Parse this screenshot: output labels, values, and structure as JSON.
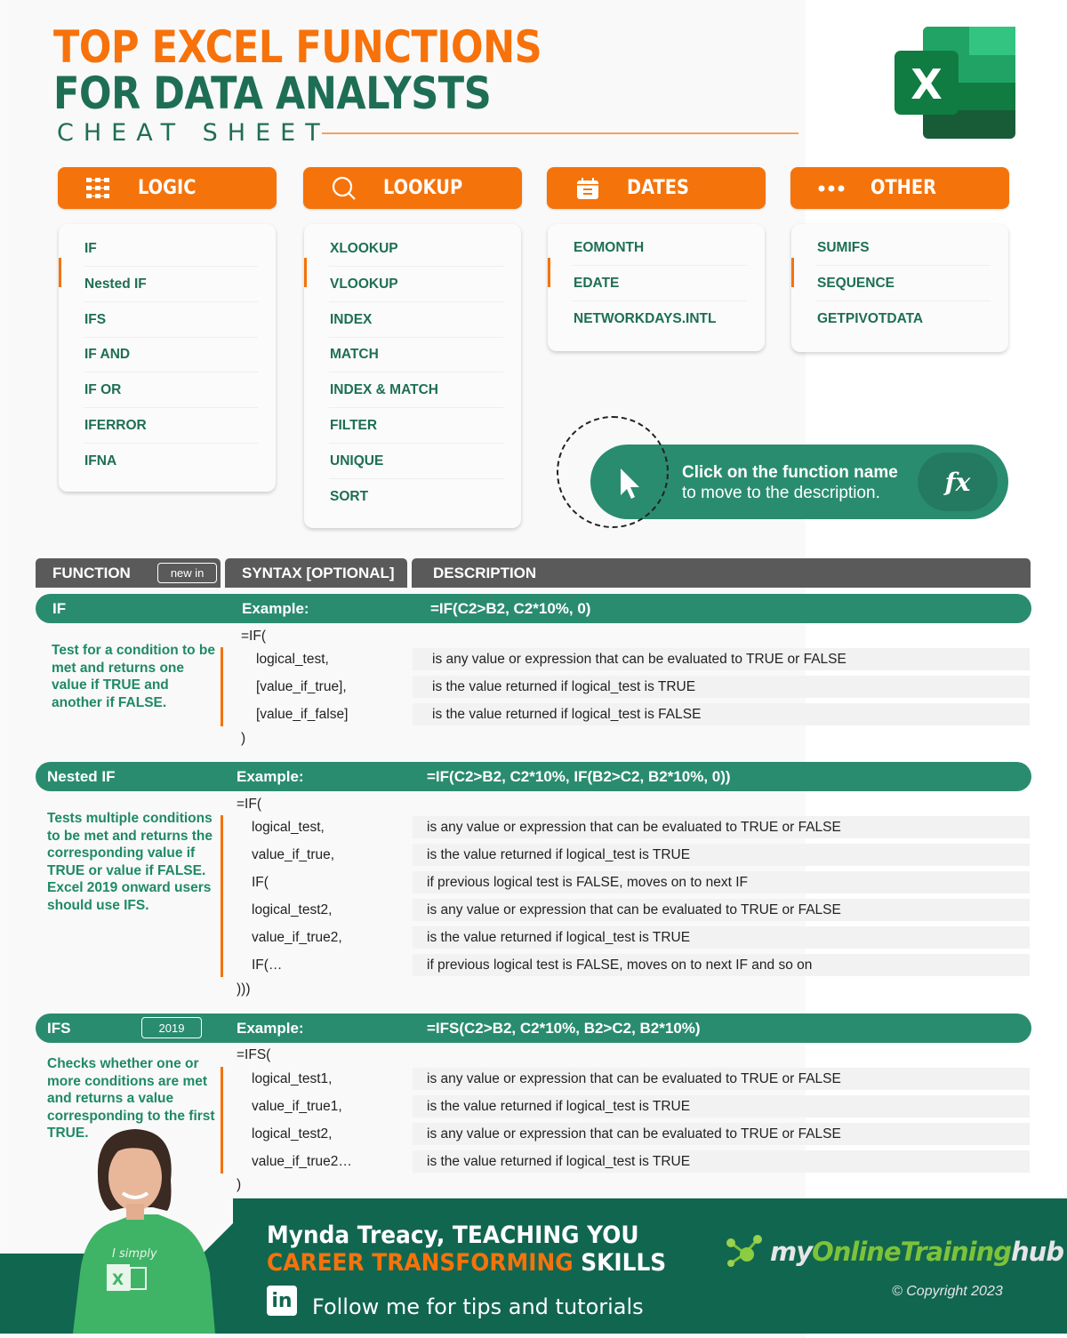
{
  "header": {
    "title_line1": "TOP EXCEL FUNCTIONS",
    "title_line2": "FOR DATA ANALYSTS",
    "subtitle": "CHEAT SHEET",
    "logo_letter": "X"
  },
  "colors": {
    "orange": "#f5730b",
    "green_dark": "#1e6e55",
    "green_bar": "#2a8c6e",
    "footer_green": "#116650",
    "header_gray": "#5a5a5a"
  },
  "categories": [
    {
      "label": "LOGIC",
      "icon": "flowchart-grid-icon",
      "items": [
        "IF",
        "Nested IF",
        "IFS",
        "IF AND",
        "IF OR",
        "IFERROR",
        "IFNA"
      ]
    },
    {
      "label": "LOOKUP",
      "icon": "search-icon",
      "items": [
        "XLOOKUP",
        "VLOOKUP",
        "INDEX",
        "MATCH",
        "INDEX & MATCH",
        "FILTER",
        "UNIQUE",
        "SORT"
      ]
    },
    {
      "label": "DATES",
      "icon": "calendar-icon",
      "items": [
        "EOMONTH",
        "EDATE",
        "NETWORKDAYS.INTL"
      ]
    },
    {
      "label": "OTHER",
      "icon": "more-dots-icon",
      "items": [
        "SUMIFS",
        "SEQUENCE",
        "GETPIVOTDATA"
      ]
    }
  ],
  "hint": {
    "bold": "Click on the function name",
    "regular": "to move to the description.",
    "fx": "fx"
  },
  "table_header": {
    "function": "FUNCTION",
    "new_in": "new in",
    "syntax": "SYNTAX [OPTIONAL]",
    "description": "DESCRIPTION"
  },
  "functions": [
    {
      "name": "IF",
      "badge": "",
      "example_label": "Example:",
      "example": "=IF(C2>B2, C2*10%, 0)",
      "summary": "Test for a condition to be met and returns one value if TRUE and another if FALSE.",
      "open": "=IF(",
      "close": ")",
      "args": [
        {
          "syntax": "logical_test,",
          "desc": "is any value or expression that can be evaluated to TRUE or FALSE"
        },
        {
          "syntax": "[value_if_true],",
          "desc": "is the value returned if logical_test is TRUE"
        },
        {
          "syntax": "[value_if_false]",
          "desc": "is the value returned if logical_test is FALSE"
        }
      ]
    },
    {
      "name": "Nested IF",
      "badge": "",
      "example_label": "Example:",
      "example": "=IF(C2>B2, C2*10%, IF(B2>C2, B2*10%, 0))",
      "summary": "Tests multiple conditions to be met and returns the corresponding value if TRUE or value if FALSE. Excel 2019 onward users should use IFS.",
      "open": "=IF(",
      "close": ")))",
      "args": [
        {
          "syntax": "logical_test,",
          "desc": "is any value or expression that can be evaluated to TRUE or FALSE"
        },
        {
          "syntax": "value_if_true,",
          "desc": "is the value returned if logical_test is TRUE"
        },
        {
          "syntax": "IF(",
          "desc": "if previous logical test is FALSE, moves on to next IF"
        },
        {
          "syntax": "logical_test2,",
          "desc": "is any value or expression that can be evaluated to TRUE or FALSE"
        },
        {
          "syntax": "value_if_true2,",
          "desc": "is the value returned if logical_test is TRUE"
        },
        {
          "syntax": "IF(…",
          "desc": "if previous logical test is FALSE, moves on to next IF and so on"
        }
      ]
    },
    {
      "name": "IFS",
      "badge": "2019",
      "example_label": "Example:",
      "example": "=IFS(C2>B2, C2*10%, B2>C2, B2*10%)",
      "summary": "Checks whether one or more conditions are met and returns a value corresponding to the first TRUE.",
      "open": "=IFS(",
      "close": ")",
      "args": [
        {
          "syntax": "logical_test1,",
          "desc": "is any value or expression that can be evaluated to TRUE or FALSE"
        },
        {
          "syntax": "value_if_true1,",
          "desc": "is the value returned if logical_test is TRUE"
        },
        {
          "syntax": "logical_test2,",
          "desc": "is any value or expression that can be evaluated to TRUE or FALSE"
        },
        {
          "syntax": "value_if_true2…",
          "desc": "is the value returned if logical_test is TRUE"
        }
      ]
    }
  ],
  "footer": {
    "line1": "Mynda Treacy, TEACHING YOU",
    "line2_orange": "CAREER TRANSFORMING",
    "line2_white": " SKILLS",
    "linkedin_label": "in",
    "follow": "Follow me for tips and tutorials",
    "brand_my": "my",
    "brand_online_training": "OnlineTraining",
    "brand_hub": "hub",
    "copyright": "© Copyright 2023",
    "shirt_text": "I simply"
  }
}
